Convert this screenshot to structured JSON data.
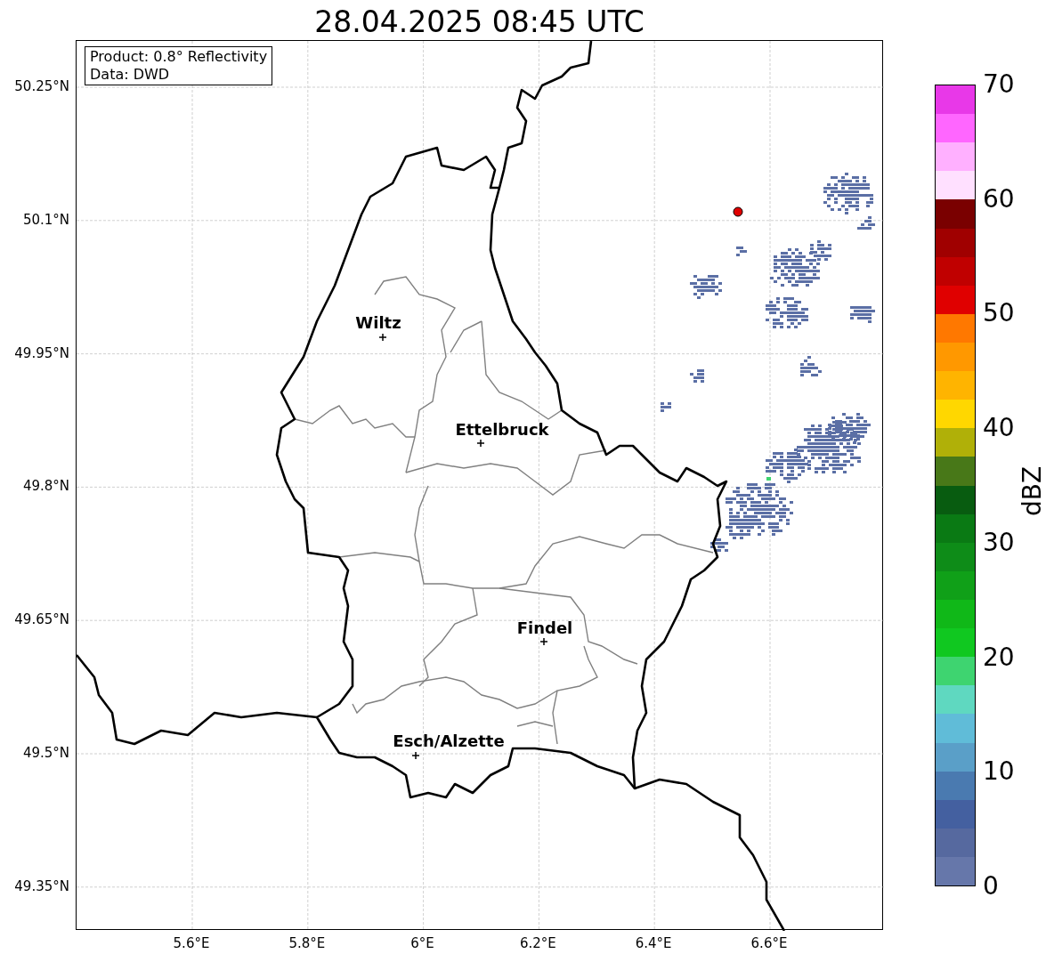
{
  "title": "28.04.2025 08:45 UTC",
  "info_box": {
    "lines": [
      "Product: 0.8° Reflectivity",
      "Data: DWD"
    ]
  },
  "map": {
    "lat_ticks": [
      "50.25°N",
      "50.1°N",
      "49.95°N",
      "49.8°N",
      "49.65°N",
      "49.5°N",
      "49.35°N"
    ],
    "lon_ticks": [
      "5.6°E",
      "5.8°E",
      "6°E",
      "6.2°E",
      "6.4°E",
      "6.6°E"
    ],
    "cities": [
      {
        "name": "Wiltz"
      },
      {
        "name": "Ettelbruck"
      },
      {
        "name": "Findel"
      },
      {
        "name": "Esch/Alzette"
      }
    ]
  },
  "colorbar": {
    "label": "dBZ",
    "ticks": [
      "70",
      "60",
      "50",
      "40",
      "30",
      "20",
      "10",
      "0"
    ],
    "bins": [
      {
        "color": "#e838e8"
      },
      {
        "color": "#ff66ff"
      },
      {
        "color": "#ffb0ff"
      },
      {
        "color": "#ffe0ff"
      },
      {
        "color": "#7a0000"
      },
      {
        "color": "#a00000"
      },
      {
        "color": "#c00000"
      },
      {
        "color": "#e00000"
      },
      {
        "color": "#ff7800"
      },
      {
        "color": "#ff9800"
      },
      {
        "color": "#ffb400"
      },
      {
        "color": "#ffd700"
      },
      {
        "color": "#b0b008"
      },
      {
        "color": "#487818"
      },
      {
        "color": "#085c10"
      },
      {
        "color": "#0a7a14"
      },
      {
        "color": "#0e8c18"
      },
      {
        "color": "#10a018"
      },
      {
        "color": "#10b818"
      },
      {
        "color": "#10c820"
      },
      {
        "color": "#3ed470"
      },
      {
        "color": "#5fd8c0"
      },
      {
        "color": "#60bcd8"
      },
      {
        "color": "#5a9fc8"
      },
      {
        "color": "#4a7ab0"
      },
      {
        "color": "#4460a0"
      },
      {
        "color": "#56699f"
      },
      {
        "color": "#6677aa"
      }
    ]
  }
}
